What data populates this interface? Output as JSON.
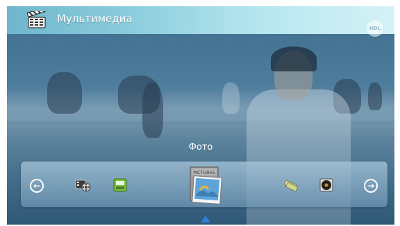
{
  "header": {
    "title": "Мультимедиа",
    "badge": "HDL"
  },
  "selected_label": "Фото",
  "carousel": {
    "items": [
      {
        "id": "video",
        "icon": "film-camera-icon"
      },
      {
        "id": "sd-card",
        "icon": "memory-card-icon"
      },
      {
        "id": "pictures",
        "icon": "pictures-folder-icon",
        "label": "PICTURES",
        "selected": true
      },
      {
        "id": "tickets",
        "icon": "tickets-icon"
      },
      {
        "id": "music",
        "icon": "vinyl-record-icon"
      }
    ]
  },
  "colors": {
    "topbar_accent": "#8fcfdf",
    "pager_indicator": "#2c7fd8"
  }
}
